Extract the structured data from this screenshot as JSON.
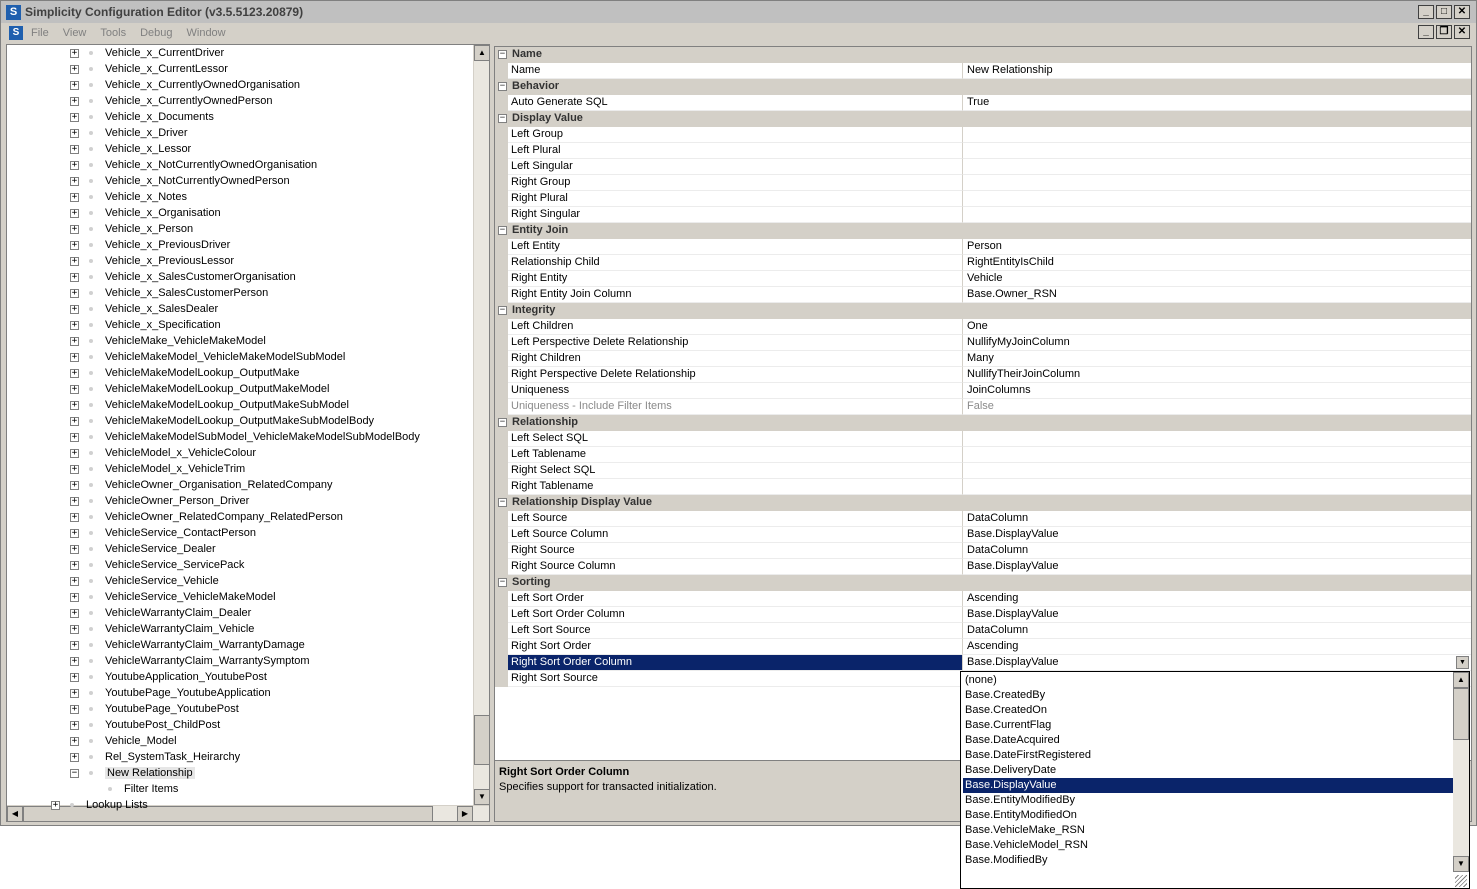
{
  "window": {
    "title": "Simplicity Configuration Editor (v3.5.5123.20879)"
  },
  "menu": [
    "File",
    "View",
    "Tools",
    "Debug",
    "Window"
  ],
  "tree": {
    "items": [
      "Vehicle_x_CurrentDriver",
      "Vehicle_x_CurrentLessor",
      "Vehicle_x_CurrentlyOwnedOrganisation",
      "Vehicle_x_CurrentlyOwnedPerson",
      "Vehicle_x_Documents",
      "Vehicle_x_Driver",
      "Vehicle_x_Lessor",
      "Vehicle_x_NotCurrentlyOwnedOrganisation",
      "Vehicle_x_NotCurrentlyOwnedPerson",
      "Vehicle_x_Notes",
      "Vehicle_x_Organisation",
      "Vehicle_x_Person",
      "Vehicle_x_PreviousDriver",
      "Vehicle_x_PreviousLessor",
      "Vehicle_x_SalesCustomerOrganisation",
      "Vehicle_x_SalesCustomerPerson",
      "Vehicle_x_SalesDealer",
      "Vehicle_x_Specification",
      "VehicleMake_VehicleMakeModel",
      "VehicleMakeModel_VehicleMakeModelSubModel",
      "VehicleMakeModelLookup_OutputMake",
      "VehicleMakeModelLookup_OutputMakeModel",
      "VehicleMakeModelLookup_OutputMakeSubModel",
      "VehicleMakeModelLookup_OutputMakeSubModelBody",
      "VehicleMakeModelSubModel_VehicleMakeModelSubModelBody",
      "VehicleModel_x_VehicleColour",
      "VehicleModel_x_VehicleTrim",
      "VehicleOwner_Organisation_RelatedCompany",
      "VehicleOwner_Person_Driver",
      "VehicleOwner_RelatedCompany_RelatedPerson",
      "VehicleService_ContactPerson",
      "VehicleService_Dealer",
      "VehicleService_ServicePack",
      "VehicleService_Vehicle",
      "VehicleService_VehicleMakeModel",
      "VehicleWarrantyClaim_Dealer",
      "VehicleWarrantyClaim_Vehicle",
      "VehicleWarrantyClaim_WarrantyDamage",
      "VehicleWarrantyClaim_WarrantySymptom",
      "YoutubeApplication_YoutubePost",
      "YoutubePage_YoutubeApplication",
      "YoutubePage_YoutubePost",
      "YoutubePost_ChildPost",
      "Vehicle_Model",
      "Rel_SystemTask_Heirarchy"
    ],
    "selected": "New Relationship",
    "child": "Filter Items",
    "next_root": "Lookup Lists"
  },
  "properties": [
    {
      "category": "Name",
      "rows": [
        [
          "Name",
          "New Relationship"
        ]
      ]
    },
    {
      "category": "Behavior",
      "rows": [
        [
          "Auto Generate SQL",
          "True"
        ]
      ]
    },
    {
      "category": "Display Value",
      "rows": [
        [
          "Left Group",
          ""
        ],
        [
          "Left Plural",
          ""
        ],
        [
          "Left Singular",
          ""
        ],
        [
          "Right Group",
          ""
        ],
        [
          "Right Plural",
          ""
        ],
        [
          "Right Singular",
          ""
        ]
      ]
    },
    {
      "category": "Entity Join",
      "rows": [
        [
          "Left Entity",
          "Person"
        ],
        [
          "Relationship Child",
          "RightEntityIsChild"
        ],
        [
          "Right Entity",
          "Vehicle"
        ],
        [
          "Right Entity Join Column",
          "Base.Owner_RSN"
        ]
      ]
    },
    {
      "category": "Integrity",
      "rows": [
        [
          "Left Children",
          "One"
        ],
        [
          "Left Perspective Delete Relationship",
          "NullifyMyJoinColumn"
        ],
        [
          "Right Children",
          "Many"
        ],
        [
          "Right Perspective Delete Relationship",
          "NullifyTheirJoinColumn"
        ],
        [
          "Uniqueness",
          "JoinColumns"
        ],
        [
          "Uniqueness - Include Filter Items",
          "False"
        ]
      ]
    },
    {
      "category": "Relationship",
      "rows": [
        [
          "Left Select SQL",
          ""
        ],
        [
          "Left Tablename",
          ""
        ],
        [
          "Right Select SQL",
          ""
        ],
        [
          "Right Tablename",
          ""
        ]
      ]
    },
    {
      "category": "Relationship Display Value",
      "rows": [
        [
          "Left Source",
          "DataColumn"
        ],
        [
          "Left Source Column",
          "Base.DisplayValue"
        ],
        [
          "Right Source",
          "DataColumn"
        ],
        [
          "Right Source Column",
          "Base.DisplayValue"
        ]
      ]
    },
    {
      "category": "Sorting",
      "rows": [
        [
          "Left Sort Order",
          "Ascending"
        ],
        [
          "Left Sort Order Column",
          "Base.DisplayValue"
        ],
        [
          "Left Sort Source",
          "DataColumn"
        ],
        [
          "Right Sort Order",
          "Ascending"
        ],
        [
          "Right Sort Order Column",
          "Base.DisplayValue"
        ],
        [
          "Right Sort Source",
          ""
        ]
      ]
    }
  ],
  "selected_property": "Right Sort Order Column",
  "disabled_property": "Uniqueness - Include Filter Items",
  "help": {
    "title": "Right Sort Order Column",
    "description": "Specifies support for transacted initialization."
  },
  "dropdown": {
    "options": [
      "(none)",
      "Base.CreatedBy",
      "Base.CreatedOn",
      "Base.CurrentFlag",
      "Base.DateAcquired",
      "Base.DateFirstRegistered",
      "Base.DeliveryDate",
      "Base.DisplayValue",
      "Base.EntityModifiedBy",
      "Base.EntityModifiedOn",
      "Base.VehicleMake_RSN",
      "Base.VehicleModel_RSN",
      "Base.ModifiedBy"
    ],
    "selected": "Base.DisplayValue"
  },
  "colors": {
    "selection": "#0a246a",
    "chrome": "#d4d0c8"
  }
}
